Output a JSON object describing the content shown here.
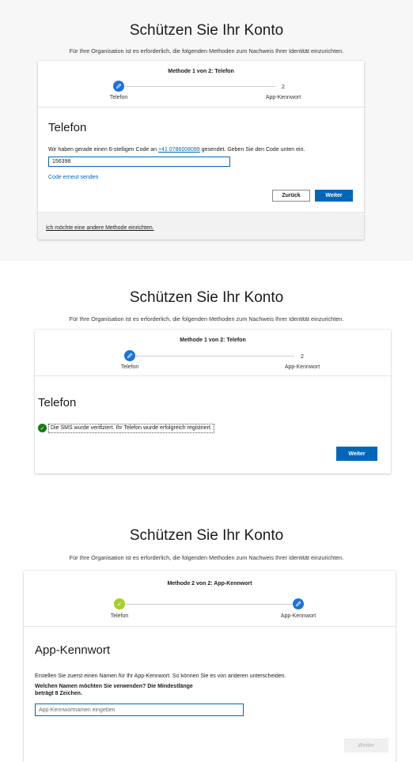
{
  "panel1": {
    "heading": "Schützen Sie Ihr Konto",
    "subtitle": "Für Ihre Organisation ist es erforderlich, die folgenden Methoden zum Nachweis Ihrer Identität einzurichten.",
    "step_title": "Methode 1 von 2: Telefon",
    "step1_label": "Telefon",
    "step2_number": "2",
    "step2_label": "App-Kennwort",
    "card_title": "Telefon",
    "instruction_prefix": "Wir haben gerade einen 6-stelligen Code an ",
    "phone_number": "+41 0786008099",
    "instruction_suffix": " gesendet. Geben Sie den Code unten ein.",
    "code_value": "156398",
    "resend_link": "Code erneut senden",
    "back_button": "Zurück",
    "next_button": "Weiter",
    "footer_link": "Ich möchte eine andere Methode einrichten."
  },
  "panel2": {
    "heading": "Schützen Sie Ihr Konto",
    "subtitle": "Für Ihre Organisation ist es erforderlich, die folgenden Methoden zum Nachweis Ihrer Identität einzurichten.",
    "step_title": "Methode 1 von 2: Telefon",
    "step1_label": "Telefon",
    "step2_number": "2",
    "step2_label": "App-Kennwort",
    "card_title": "Telefon",
    "success_message": "Die SMS wurde verifiziert. Ihr Telefon wurde erfolgreich registriert.",
    "next_button": "Weiter"
  },
  "panel3": {
    "heading": "Schützen Sie Ihr Konto",
    "subtitle": "Für Ihre Organisation ist es erforderlich, die folgenden Methoden zum Nachweis Ihrer Identität einzurichten.",
    "step_title": "Methode 2 von 2: App-Kennwort",
    "step1_label": "Telefon",
    "step2_label": "App-Kennwort",
    "card_title": "App-Kennwort",
    "instruction": "Erstellen Sie zuerst einen Namen für Ihr App-Kennwort. So können Sie es von anderen unterscheiden.",
    "question_line1": "Welchen Namen möchten Sie verwenden? Die Mindestlänge",
    "question_line2": "beträgt 8 Zeichen.",
    "name_placeholder": "App-Kennwortnamen eingeben",
    "name_value": "",
    "next_button": "Weiter"
  },
  "icons": {
    "current_step": "pencil-icon",
    "completed_step": "checkmark-icon",
    "success": "checkmark-circle-icon"
  },
  "colors": {
    "accent": "#0067b8",
    "step_blue": "#1a73d8",
    "step_done": "#a6cf2a",
    "success": "#107c10"
  }
}
